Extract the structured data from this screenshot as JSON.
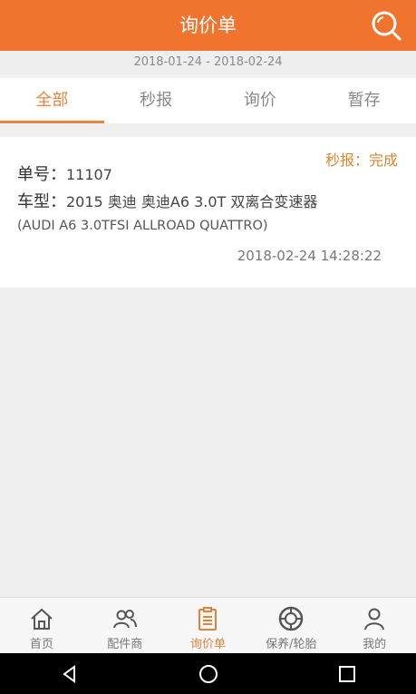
{
  "header": {
    "title": "询价单",
    "search_icon": "search-icon"
  },
  "date_range": "2018-01-24 - 2018-02-24",
  "tabs": [
    {
      "label": "全部",
      "active": true
    },
    {
      "label": "秒报",
      "active": false
    },
    {
      "label": "询价",
      "active": false
    },
    {
      "label": "暂存",
      "active": false
    }
  ],
  "order": {
    "status": "秒报：完成",
    "number_label": "单号：",
    "number": "11107",
    "model_label": "车型：",
    "model": "2015 奥迪 奥迪A6 3.0T 双离合变速器",
    "model_en": "(AUDI A6 3.0TFSI ALLROAD QUATTRO)",
    "time": "2018-02-24 14:28:22"
  },
  "bottom_nav": [
    {
      "label": "首页",
      "icon": "home-icon",
      "active": false
    },
    {
      "label": "配件商",
      "icon": "users-icon",
      "active": false
    },
    {
      "label": "询价单",
      "icon": "clipboard-icon",
      "active": true
    },
    {
      "label": "保养/轮胎",
      "icon": "tire-icon",
      "active": false
    },
    {
      "label": "我的",
      "icon": "person-icon",
      "active": false
    }
  ],
  "colors": {
    "brand": "#f0742e",
    "accent": "#e7863b"
  }
}
